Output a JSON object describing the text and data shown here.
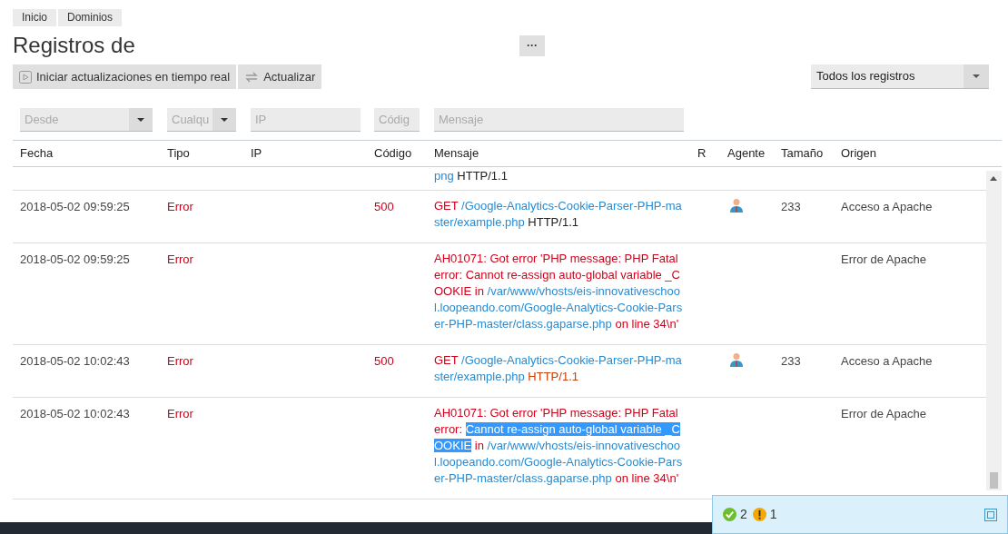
{
  "breadcrumb": [
    {
      "label": "Inicio"
    },
    {
      "label": "Dominios"
    }
  ],
  "title": "Registros de",
  "more_button": "···",
  "toolbar": {
    "buttons": [
      {
        "label": "Iniciar actualizaciones en tiempo real",
        "kind": "play"
      },
      {
        "label": "Actualizar",
        "kind": "refresh"
      }
    ],
    "log_select": "Todos los registros"
  },
  "filters": [
    {
      "placeholder": "Desde",
      "kind": "select"
    },
    {
      "placeholder": "Cualqu",
      "kind": "select"
    },
    {
      "placeholder": "IP",
      "kind": "text"
    },
    {
      "placeholder": "Códig",
      "kind": "text"
    },
    {
      "placeholder": "Mensaje",
      "kind": "text"
    }
  ],
  "table": {
    "columns": [
      "Fecha",
      "Tipo",
      "IP",
      "Código",
      "Mensaje",
      "R",
      "Agente",
      "Tamaño",
      "Origen"
    ],
    "rows": [
      {
        "message": [
          {
            "text": "png",
            "kind": "link"
          },
          {
            "text": " HTTP/1.1",
            "kind": "plain"
          }
        ]
      },
      {
        "fecha": "2018-05-02 09:59:25",
        "tipo": "Error",
        "codigo": "500",
        "agent": true,
        "tamano": "233",
        "origen": "Acceso a Apache",
        "message": [
          {
            "text": "GET ",
            "kind": "error"
          },
          {
            "text": "/Google-Analytics-Cookie-Parser-PHP-master/example.php",
            "kind": "link"
          },
          {
            "text": " HTTP/1.1",
            "kind": "plain"
          }
        ]
      },
      {
        "fecha": "2018-05-02 09:59:25",
        "tipo": "Error",
        "agent": false,
        "origen": "Error de Apache",
        "message": [
          {
            "text": "AH01071: Got error 'PHP message: PHP Fatal error: Cannot re-assign auto-global variable _COOKIE in ",
            "kind": "error"
          },
          {
            "text": "/var/www/vhosts/eis-innovativeschool.loopeando.com/Google-Analytics-Cookie-Parser-PHP-master/class.gaparse.php",
            "kind": "link"
          },
          {
            "text": " on line 34\\n'",
            "kind": "error"
          }
        ]
      },
      {
        "fecha": "2018-05-02 10:02:43",
        "tipo": "Error",
        "codigo": "500",
        "agent": true,
        "tamano": "233",
        "origen": "Acceso a Apache",
        "message": [
          {
            "text": "GET ",
            "kind": "error"
          },
          {
            "text": "/Google-Analytics-Cookie-Parser-PHP-master/example.php",
            "kind": "link"
          },
          {
            "text": " HTTP/1.1",
            "kind": "warn"
          }
        ]
      },
      {
        "fecha": "2018-05-02 10:02:43",
        "tipo": "Error",
        "agent": false,
        "origen": "Error de Apache",
        "message": [
          {
            "text": "AH01071: Got error 'PHP message: PHP Fatal error: ",
            "kind": "error"
          },
          {
            "text": "Cannot re-assign auto-global variable _COOKIE",
            "kind": "selected"
          },
          {
            "text": " in ",
            "kind": "error"
          },
          {
            "text": "/var/www/vhosts/eis-innovativeschool.loopeando.com/Google-Analytics-Cookie-Parser-PHP-master/class.gaparse.php",
            "kind": "link"
          },
          {
            "text": " on line 34\\n'",
            "kind": "error"
          }
        ]
      }
    ]
  },
  "notifications": [
    {
      "count": "2",
      "kind": "success"
    },
    {
      "count": "1",
      "kind": "warning"
    }
  ]
}
